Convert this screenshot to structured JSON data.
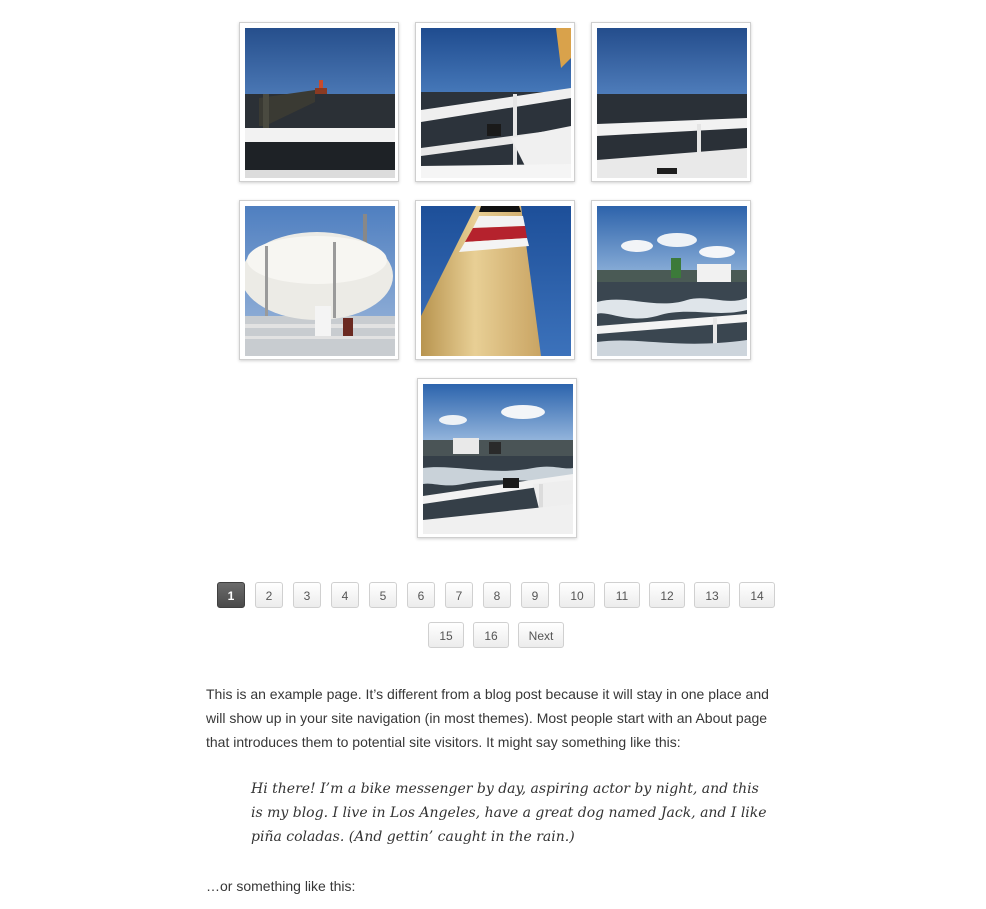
{
  "gallery": {
    "images": [
      {
        "alt": "pier-with-lighthouse"
      },
      {
        "alt": "ship-railing-sea"
      },
      {
        "alt": "railing-horizon"
      },
      {
        "alt": "lifeboat-capsule"
      },
      {
        "alt": "ship-funnel"
      },
      {
        "alt": "harbor-with-ferry"
      },
      {
        "alt": "ship-deck-harbor"
      }
    ]
  },
  "pagination": {
    "current": "1",
    "pages": [
      "1",
      "2",
      "3",
      "4",
      "5",
      "6",
      "7",
      "8",
      "9",
      "10",
      "11",
      "12",
      "13",
      "14",
      "15",
      "16"
    ],
    "next_label": "Next"
  },
  "content": {
    "intro": "This is an example page. It’s different from a blog post because it will stay in one place and will show up in your site navigation (in most themes). Most people start with an About page that introduces them to potential site visitors. It might say something like this:",
    "quote": "Hi there! I’m a bike messenger by day, aspiring actor by night, and this is my blog. I live in Los Angeles, have a great dog named Jack, and I like piña coladas. (And gettin’ caught in the rain.)",
    "outro": "…or something like this:"
  },
  "colors": {
    "page_bg": "#ffffff",
    "text": "#373737",
    "current_page_bg": "#555555",
    "sky": "#2f5e9e",
    "sea": "#2a3038"
  }
}
